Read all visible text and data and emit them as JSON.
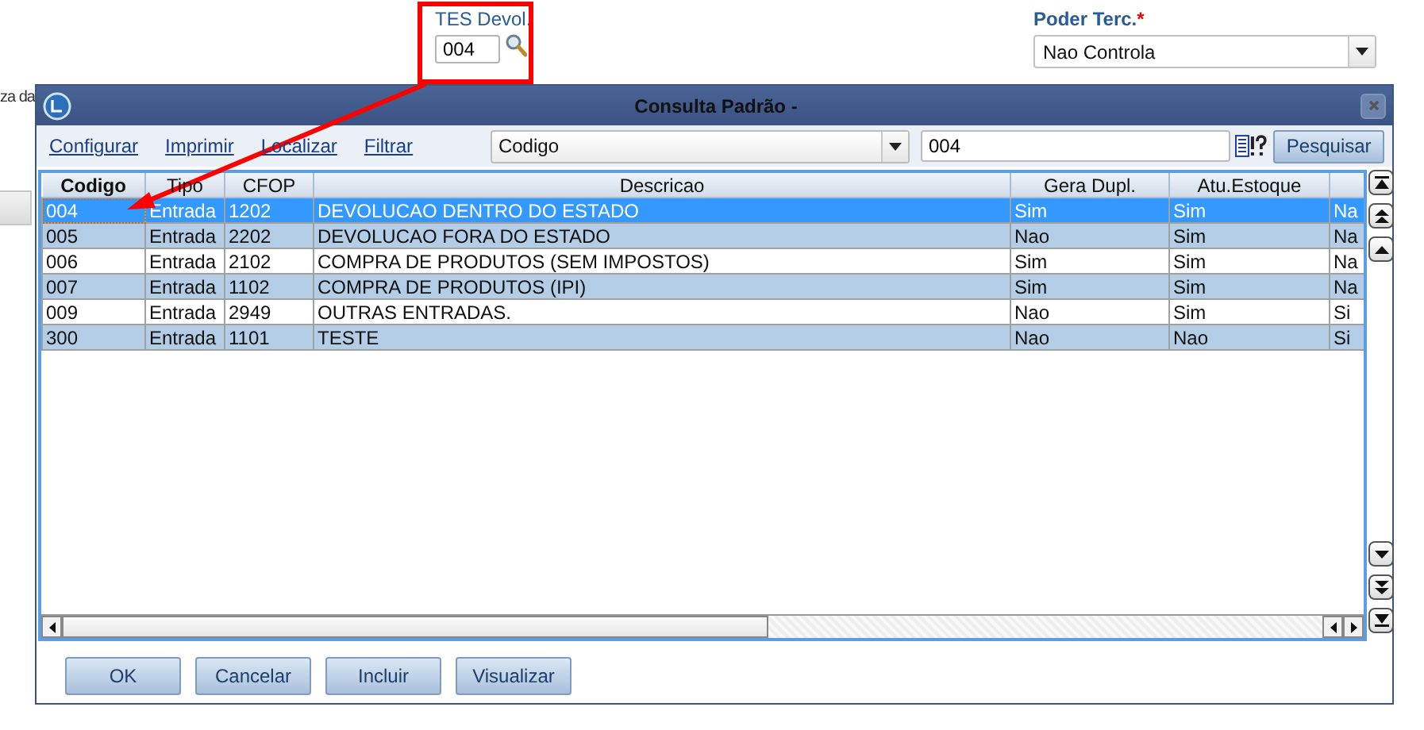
{
  "page": {
    "partial_label": "za da",
    "tes_devol": {
      "label": "TES Devol.",
      "value": "004"
    },
    "poder_terc": {
      "label": "Poder Terc.",
      "required_mark": "*",
      "value": "Nao Controla"
    }
  },
  "dialog": {
    "title": "Consulta Padrão -",
    "links": [
      "Configurar",
      "Imprimir",
      "Localizar",
      "Filtrar"
    ],
    "search": {
      "field": "Codigo",
      "value": "004",
      "button": "Pesquisar"
    },
    "table": {
      "columns": [
        "Codigo",
        "Tipo",
        "CFOP",
        "Descricao",
        "Gera Dupl.",
        "Atu.Estoque"
      ],
      "rows": [
        {
          "selected": true,
          "cells": [
            "004",
            "Entrada",
            "1202",
            "DEVOLUCAO DENTRO DO ESTADO",
            "Sim",
            "Sim",
            "Na"
          ]
        },
        {
          "selected": false,
          "cells": [
            "005",
            "Entrada",
            "2202",
            "DEVOLUCAO FORA DO ESTADO",
            "Nao",
            "Sim",
            "Na"
          ]
        },
        {
          "selected": false,
          "cells": [
            "006",
            "Entrada",
            "2102",
            "COMPRA DE PRODUTOS (SEM IMPOSTOS)",
            "Sim",
            "Sim",
            "Na"
          ]
        },
        {
          "selected": false,
          "cells": [
            "007",
            "Entrada",
            "1102",
            "COMPRA DE PRODUTOS (IPI)",
            "Sim",
            "Sim",
            "Na"
          ]
        },
        {
          "selected": false,
          "cells": [
            "009",
            "Entrada",
            "2949",
            "OUTRAS ENTRADAS.",
            "Nao",
            "Sim",
            "Si"
          ]
        },
        {
          "selected": false,
          "cells": [
            "300",
            "Entrada",
            "1101",
            "TESTE",
            "Nao",
            "Nao",
            "Si"
          ]
        }
      ]
    },
    "buttons": [
      "OK",
      "Cancelar",
      "Incluir",
      "Visualizar"
    ]
  }
}
